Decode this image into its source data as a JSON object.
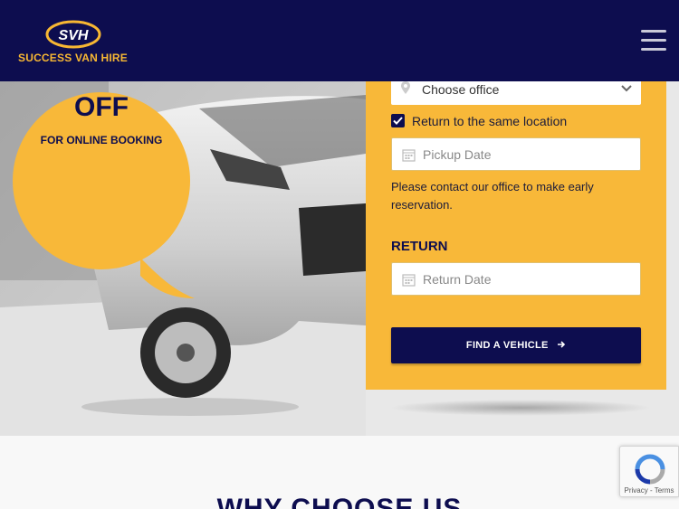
{
  "header": {
    "brand_name": "SUCCESS VAN HIRE",
    "logo_letters": "SVH",
    "menu_icon": "hamburger-menu-icon"
  },
  "promo": {
    "off_text": "OFF",
    "subtitle": "FOR ONLINE BOOKING"
  },
  "booking_form": {
    "office_select": {
      "value": "Choose office",
      "icon": "map-pin-icon"
    },
    "same_location": {
      "label": "Return to the same location",
      "checked": true
    },
    "pickup_date": {
      "placeholder": "Pickup Date",
      "icon": "calendar-icon"
    },
    "note": "Please contact our office to make early reservation.",
    "return_title": "RETURN",
    "return_date": {
      "placeholder": "Return Date",
      "icon": "calendar-icon"
    },
    "submit_label": "FIND A VEHICLE",
    "submit_icon": "arrow-right-icon"
  },
  "section": {
    "title": "WHY CHOOSE US"
  },
  "recaptcha": {
    "footer": "Privacy - Terms"
  },
  "colors": {
    "navy": "#0d0d4f",
    "accent": "#f8b839"
  }
}
